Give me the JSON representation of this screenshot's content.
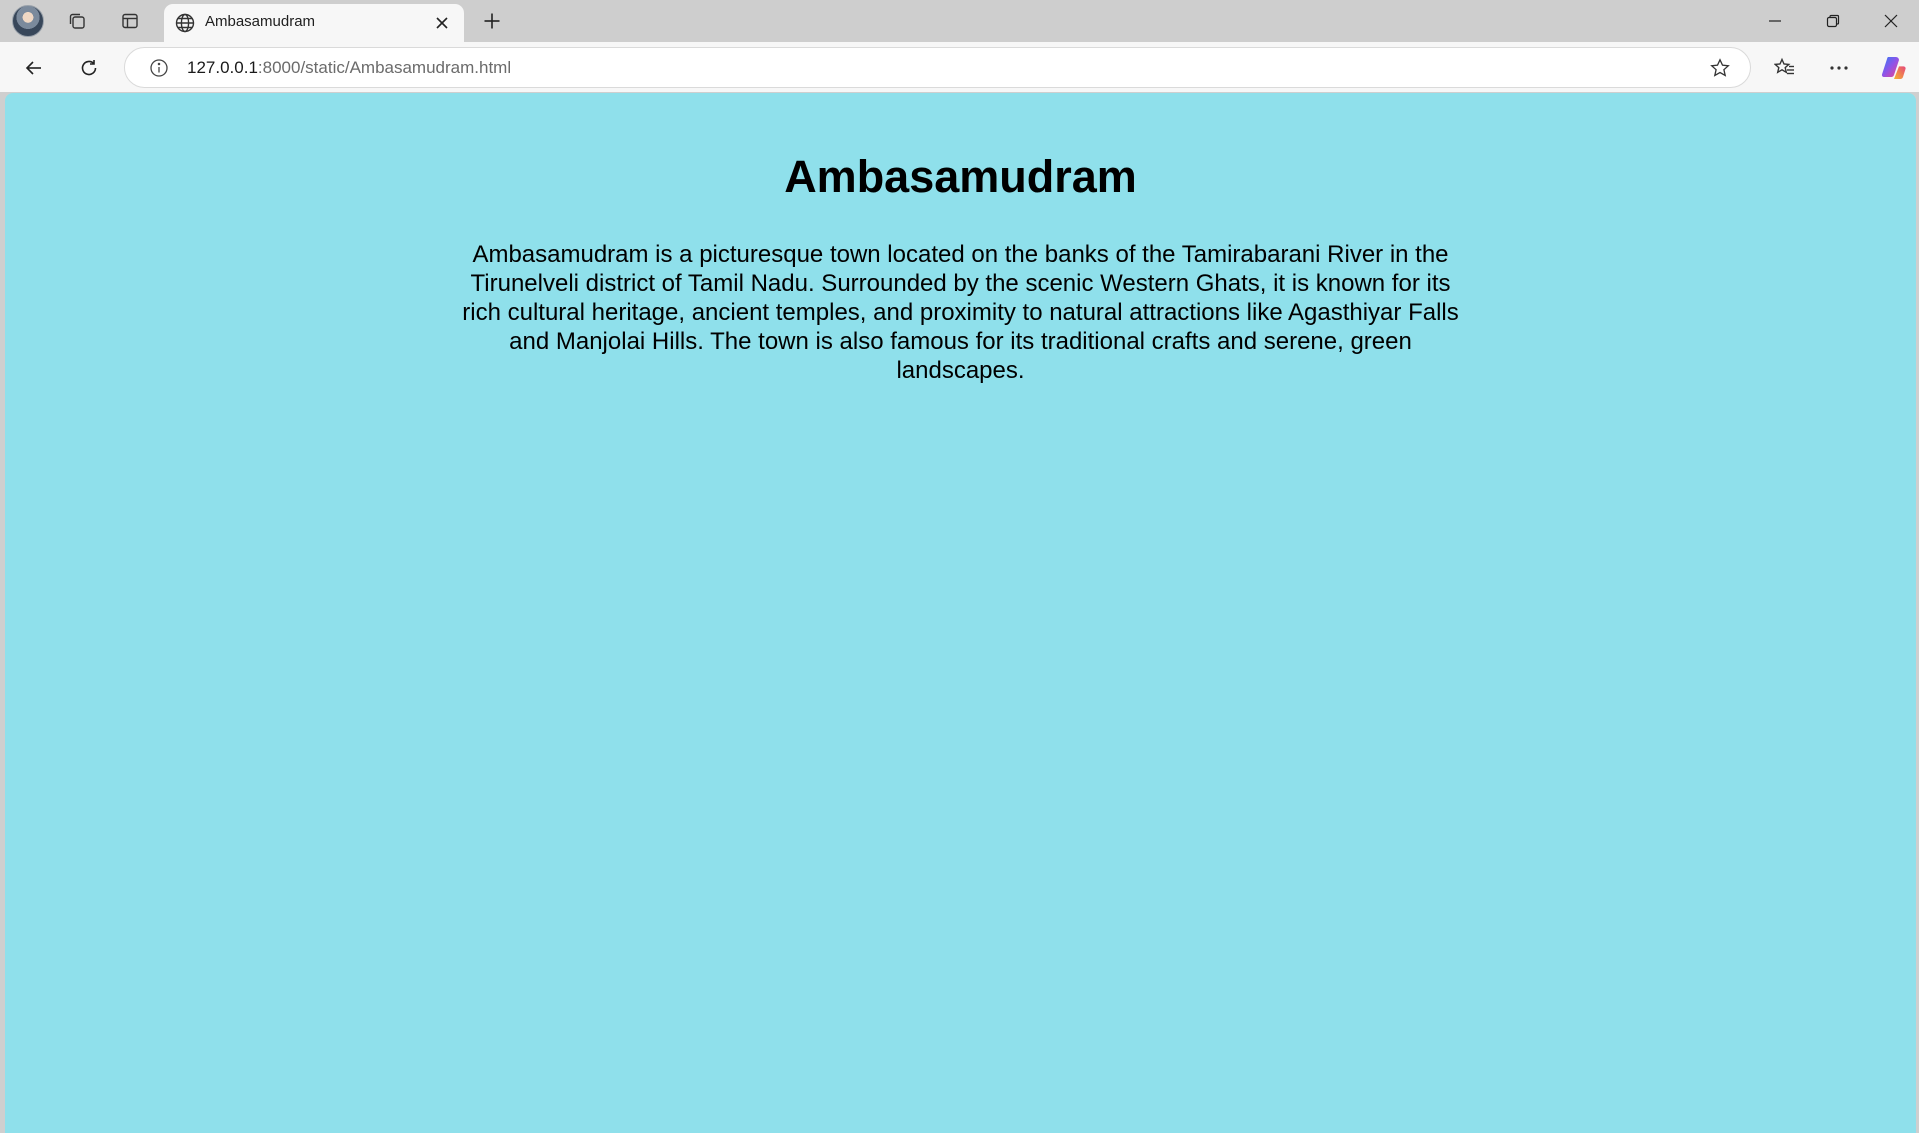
{
  "browser": {
    "tab": {
      "title": "Ambasamudram"
    },
    "address_bar": {
      "url_host": "127.0.0.1",
      "url_path": ":8000/static/Ambasamudram.html"
    }
  },
  "page": {
    "title": "Ambasamudram",
    "description": "Ambasamudram is a picturesque town located on the banks of the Tamirabarani River in the Tirunelveli district of Tamil Nadu. Surrounded by the scenic Western Ghats, it is known for its rich cultural heritage, ancient temples, and proximity to natural attractions like Agasthiyar Falls and Manjolai Hills. The town is also famous for its traditional crafts and serene, green landscapes.",
    "background_color": "#8fe0eb"
  },
  "icons": {
    "profile": "avatar",
    "workspaces": "workspaces-icon",
    "tab_actions": "tab-actions-icon",
    "tab_favicon": "globe-icon",
    "close_tab": "close-icon",
    "new_tab": "plus-icon",
    "minimize": "minimize-icon",
    "restore": "restore-icon",
    "close_window": "close-icon",
    "back": "back-arrow-icon",
    "refresh": "refresh-icon",
    "site_info": "info-icon",
    "favorite": "star-icon",
    "favorites": "favorites-icon",
    "more": "more-icon",
    "copilot": "copilot-icon"
  }
}
